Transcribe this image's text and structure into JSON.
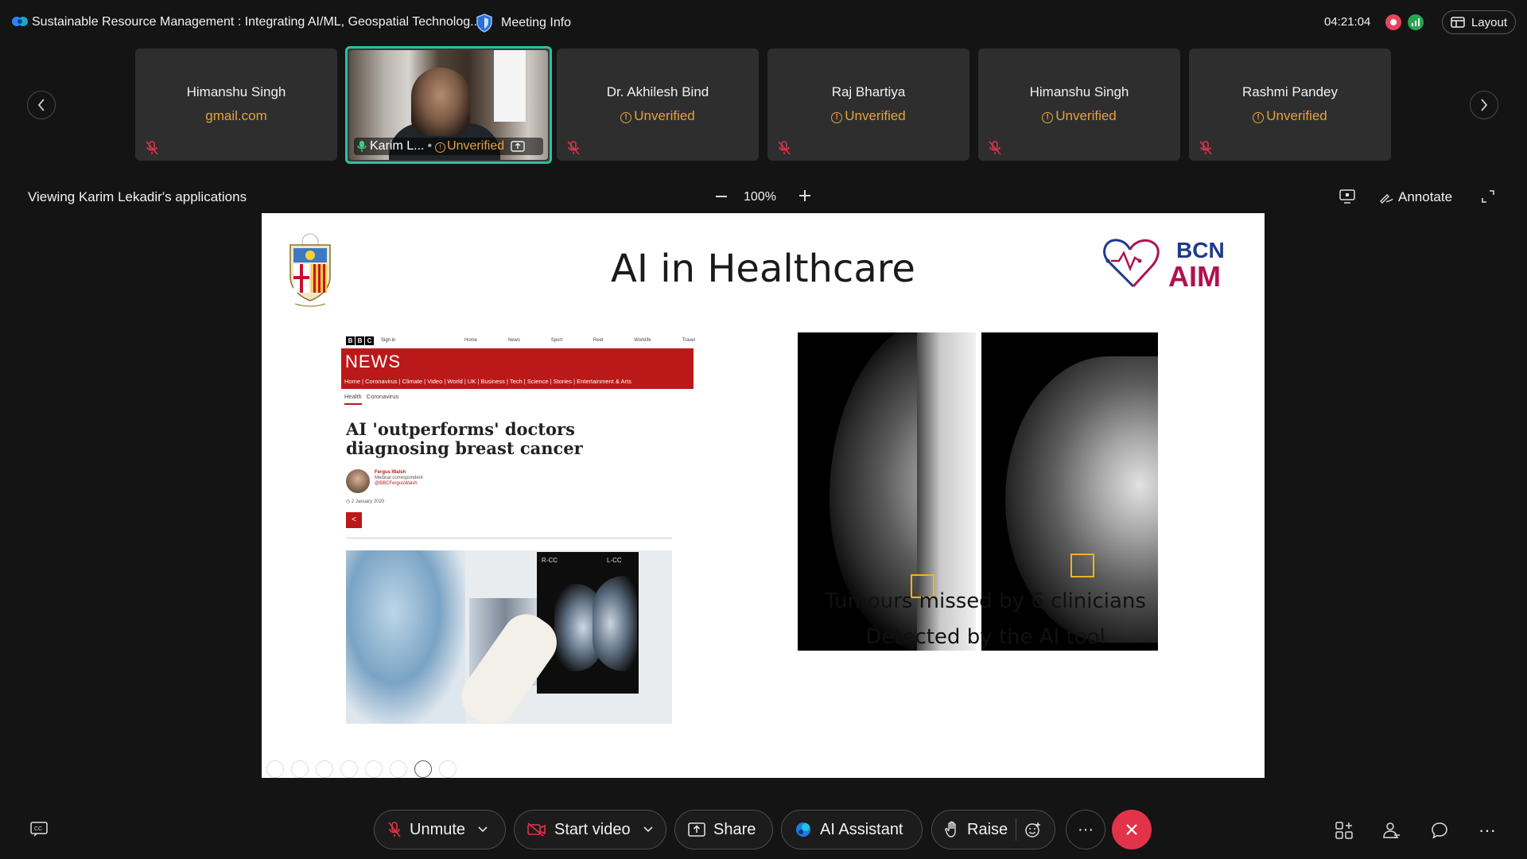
{
  "topbar": {
    "title": "Sustainable Resource Management : Integrating AI/ML, Geospatial Technolog...",
    "meeting_info": "Meeting Info",
    "clock": "04:21:04",
    "layout_label": "Layout"
  },
  "participants": [
    {
      "name": "Himanshu Singh",
      "sub": "gmail.com",
      "verified": true
    },
    {
      "name": "Karim L...",
      "sub": "Unverified",
      "active": true
    },
    {
      "name": "Dr. Akhilesh Bind",
      "sub": "Unverified"
    },
    {
      "name": "Raj Bhartiya",
      "sub": "Unverified"
    },
    {
      "name": "Himanshu Singh",
      "sub": "Unverified"
    },
    {
      "name": "Rashmi Pandey",
      "sub": "Unverified"
    }
  ],
  "share": {
    "viewing": "Viewing Karim Lekadir's applications",
    "zoom": "100%",
    "annotate": "Annotate"
  },
  "slide": {
    "title": "AI in Healthcare",
    "logo_text_top": "BCN",
    "logo_text_bottom": "AIM",
    "caption1": "Tumours missed by 6 clinicians",
    "caption2": "Detected by the AI tool",
    "bbc": {
      "boxes": [
        "B",
        "B",
        "C"
      ],
      "signin": "Sign in",
      "topnav": [
        "Home",
        "News",
        "Sport",
        "Reel",
        "Worklife",
        "Travel"
      ],
      "brand": "NEWS",
      "rednav": "Home | Coronavirus | Climate | Video | World | UK | Business | Tech | Science | Stories | Entertainment & Arts",
      "subnav_active": "Health",
      "subnav_other": "Coronavirus",
      "headline": "AI 'outperforms' doctors diagnosing breast cancer",
      "author_name": "Fergus Walsh",
      "author_role": "Medical correspondent",
      "author_handle": "@BBCFergusWalsh",
      "date": "2 January 2020",
      "film_left": "R-CC",
      "film_right": "L-CC"
    }
  },
  "controls": {
    "unmute": "Unmute",
    "start_video": "Start video",
    "share": "Share",
    "ai_assistant": "AI Assistant",
    "raise": "Raise",
    "more": "···",
    "right_more": "···"
  },
  "colors": {
    "accent_teal": "#2fbfa0",
    "warning": "#e6a23c",
    "leave": "#e3334a",
    "bbc_red": "#bb1919",
    "bcn_blue": "#1e3a8a",
    "bcn_magenta": "#b0124f"
  }
}
